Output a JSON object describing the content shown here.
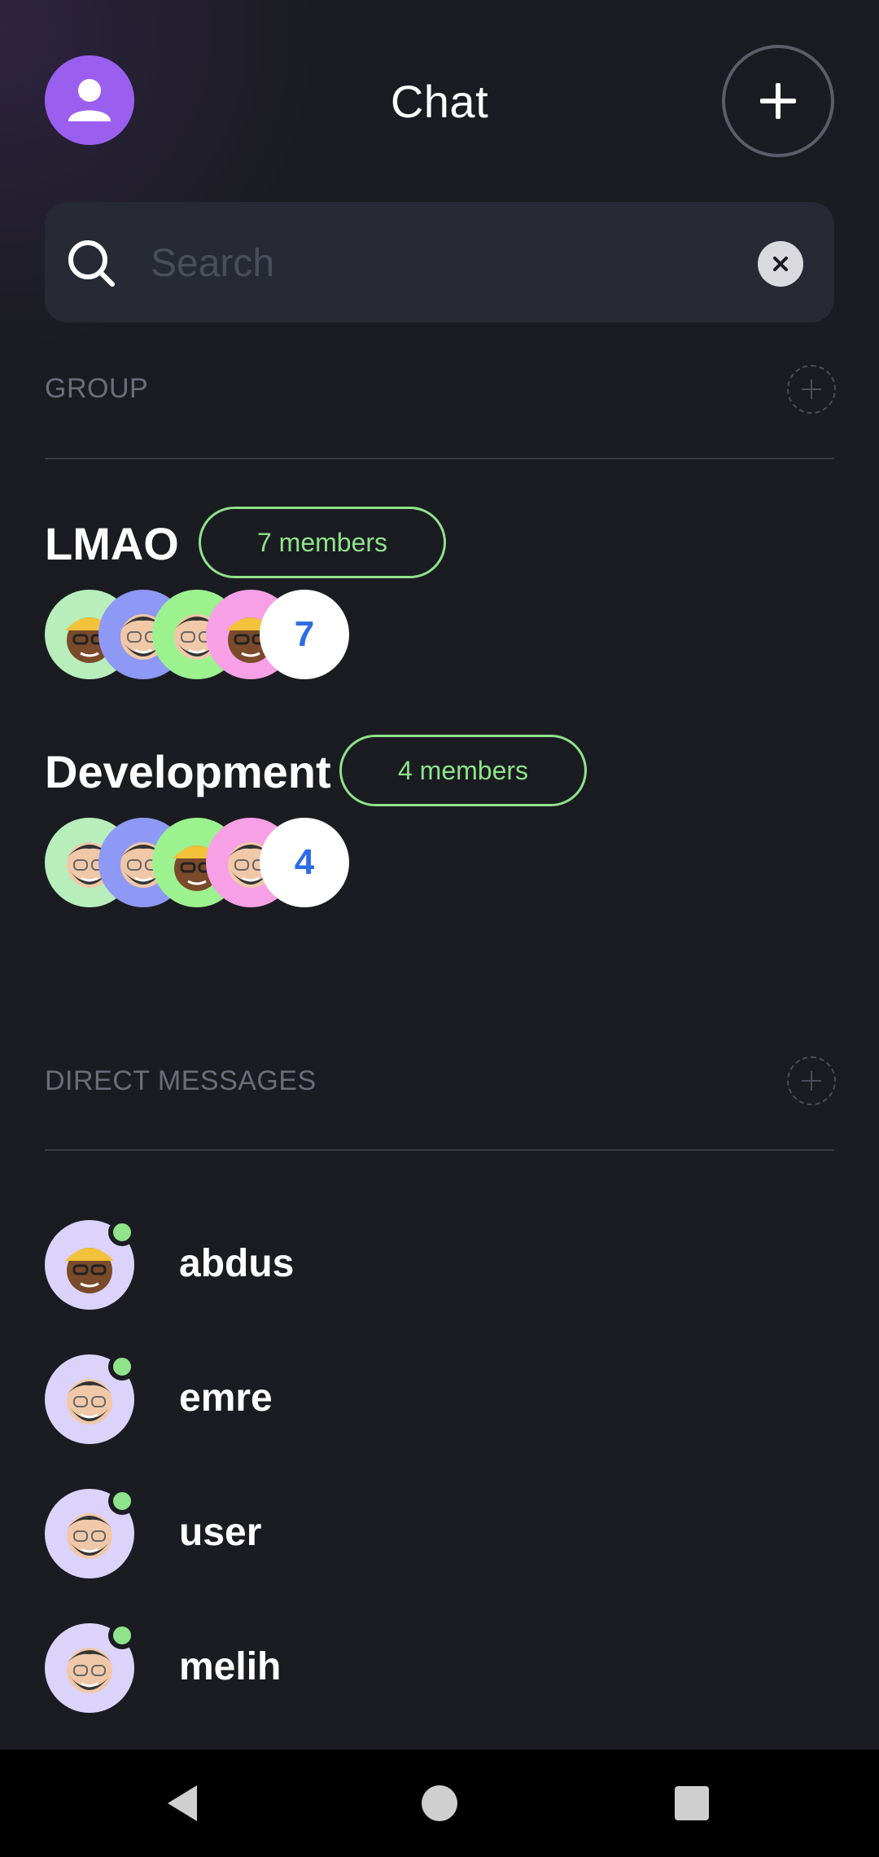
{
  "header": {
    "title": "Chat"
  },
  "search": {
    "placeholder": "Search",
    "value": ""
  },
  "groups_section": {
    "label": "GROUP",
    "groups": [
      {
        "name": "LMAO",
        "members_label": "7 members",
        "count": "7"
      },
      {
        "name": "Development",
        "members_label": "4 members",
        "count": "4"
      }
    ]
  },
  "dm_section": {
    "label": "DIRECT MESSAGES",
    "items": [
      {
        "name": "abdus",
        "avatar": "memoji-cap-glasses",
        "status": "online"
      },
      {
        "name": "emre",
        "avatar": "memoji-beard-glasses",
        "status": "online"
      },
      {
        "name": "user",
        "avatar": "memoji-beard-glasses",
        "status": "online"
      },
      {
        "name": "melih",
        "avatar": "memoji-beard-glasses",
        "status": "online"
      }
    ]
  },
  "colors": {
    "background": "#1b1c22",
    "accent_purple": "#9b5ff0",
    "online_green": "#8fe38a",
    "badge_green": "#8fe38a",
    "count_blue": "#2c6be8"
  },
  "icons": {
    "profile": "user-icon",
    "new_chat": "plus-icon",
    "search": "search-icon",
    "clear": "close-icon",
    "section_add": "add-circle-dashed-icon",
    "nav_back": "back-triangle-icon",
    "nav_home": "home-circle-icon",
    "nav_recents": "recents-square-icon"
  }
}
